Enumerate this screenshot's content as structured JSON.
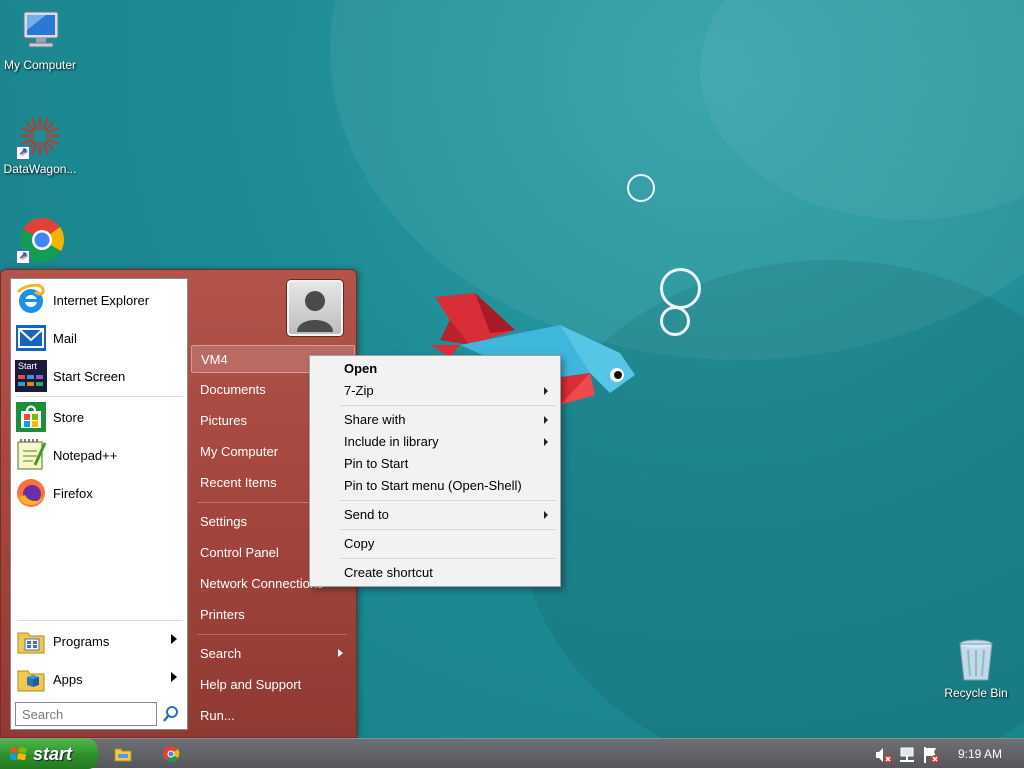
{
  "desktop": {
    "icons": [
      {
        "label": "My Computer"
      },
      {
        "label": "DataWagon..."
      },
      {
        "label": "Google Chrome"
      },
      {
        "label": "Recycle Bin"
      }
    ]
  },
  "start_menu": {
    "pinned": [
      {
        "label": "Internet Explorer",
        "icon": "internet-explorer-icon"
      },
      {
        "label": "Mail",
        "icon": "mail-icon"
      },
      {
        "label": "Start Screen",
        "icon": "start-screen-icon",
        "icon_text": "Start"
      },
      {
        "label": "Store",
        "icon": "store-icon"
      },
      {
        "label": "Notepad++",
        "icon": "notepadpp-icon"
      },
      {
        "label": "Firefox",
        "icon": "firefox-icon"
      }
    ],
    "programs_label": "Programs",
    "apps_label": "Apps",
    "search_placeholder": "Search",
    "right_items": [
      {
        "label": "VM4"
      },
      {
        "label": "Documents"
      },
      {
        "label": "Pictures"
      },
      {
        "label": "My Computer"
      },
      {
        "label": "Recent Items"
      },
      {
        "label": "Settings"
      },
      {
        "label": "Control Panel"
      },
      {
        "label": "Network Connections"
      },
      {
        "label": "Printers"
      },
      {
        "label": "Search"
      },
      {
        "label": "Help and Support"
      },
      {
        "label": "Run..."
      }
    ]
  },
  "context_menu": {
    "items": [
      {
        "label": "Open",
        "bold": true
      },
      {
        "label": "7-Zip",
        "submenu": true
      },
      {
        "label": "Share with",
        "submenu": true
      },
      {
        "label": "Include in library",
        "submenu": true
      },
      {
        "label": "Pin to Start"
      },
      {
        "label": "Pin to Start menu (Open-Shell)"
      },
      {
        "label": "Send to",
        "submenu": true
      },
      {
        "label": "Copy"
      },
      {
        "label": "Create shortcut"
      }
    ]
  },
  "taskbar": {
    "start_label": "start",
    "clock": "9:19 AM"
  },
  "colors": {
    "desktop_teal": "#1e8c95",
    "start_menu_red": "#a3463e",
    "start_button_green": "#2f8f2a",
    "taskbar_gray": "#5f6166"
  }
}
